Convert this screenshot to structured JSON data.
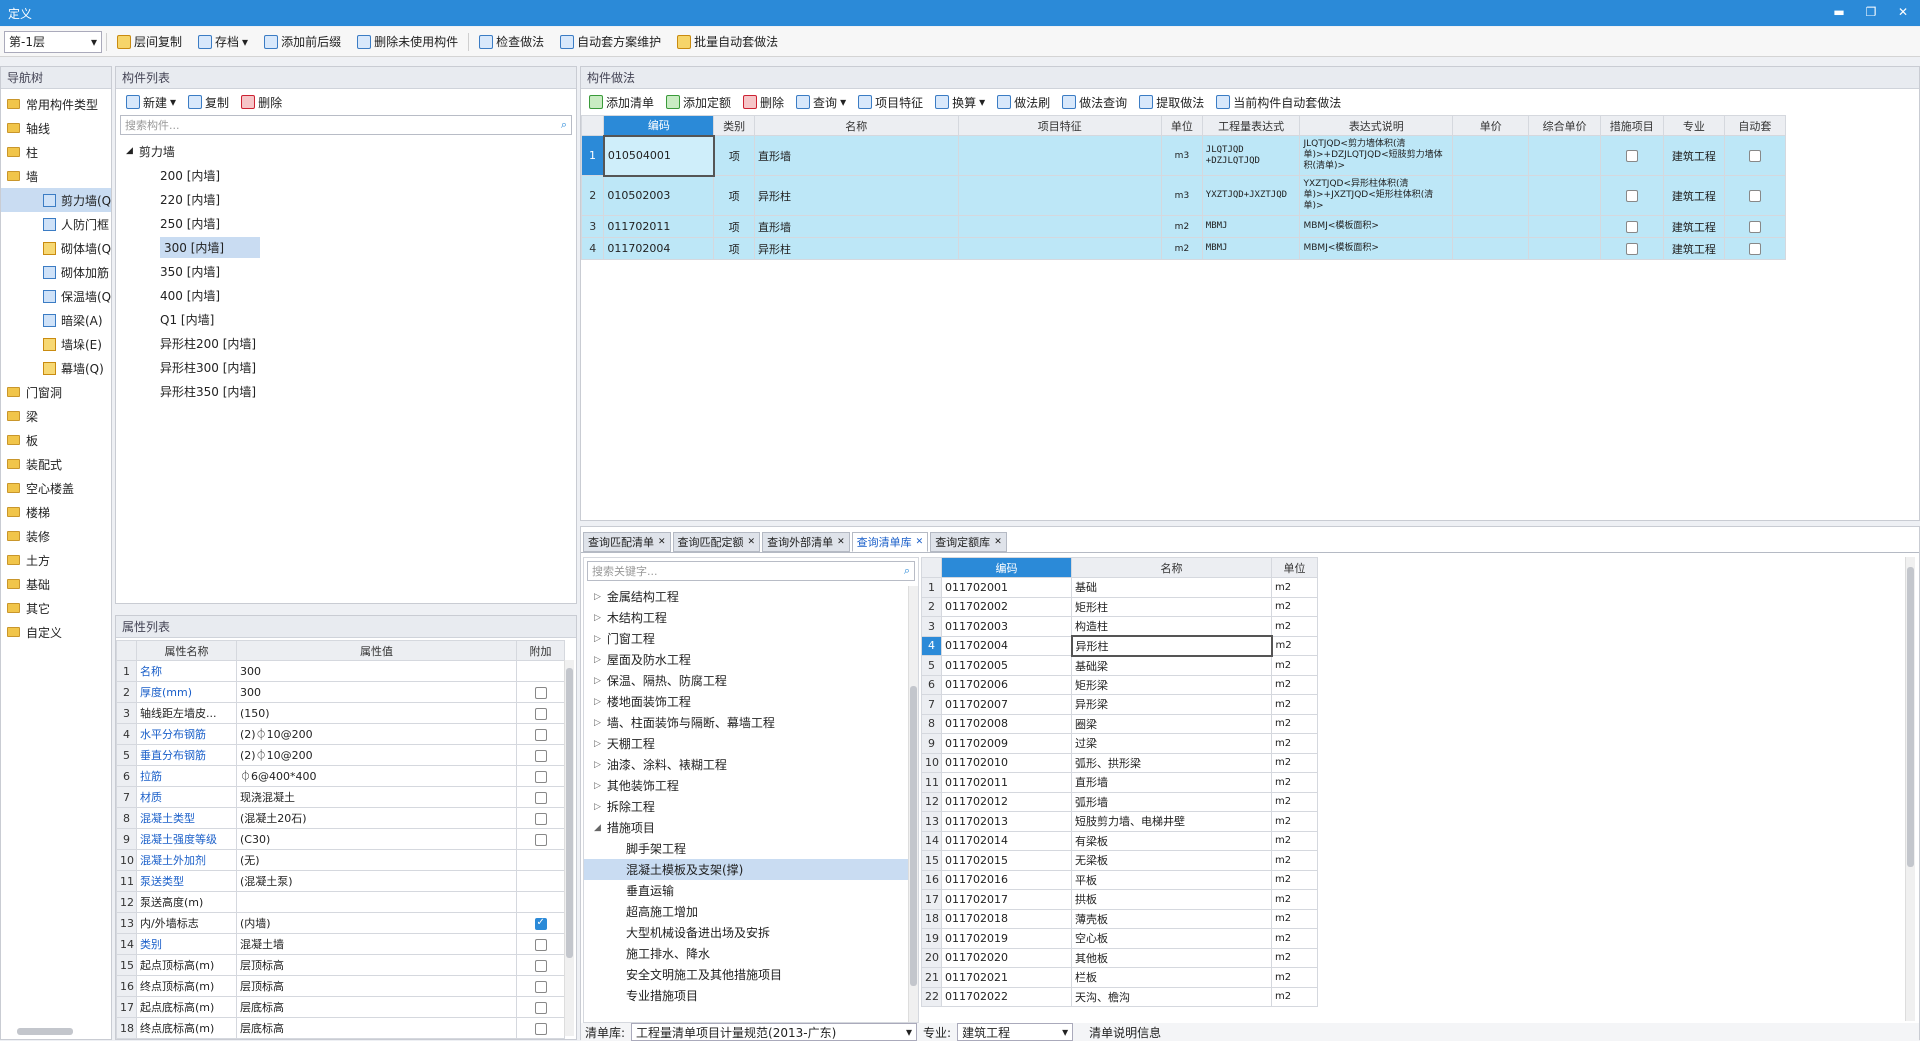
{
  "window": {
    "title": "定义",
    "min": "▬",
    "restore": "❐",
    "close": "✕"
  },
  "toolbar": {
    "floor": "第-1层",
    "items": [
      "层间复制",
      "存档",
      "添加前后缀",
      "删除未使用构件",
      "检查做法",
      "自动套方案维护",
      "批量自动套做法"
    ]
  },
  "nav": {
    "title": "导航树",
    "top": [
      {
        "label": "常用构件类型"
      },
      {
        "label": "轴线"
      },
      {
        "label": "柱"
      },
      {
        "label": "墙"
      }
    ],
    "wall_children": [
      "剪力墙(Q)",
      "人防门框",
      "砌体墙(Q)",
      "砌体加筋",
      "保温墙(Q)",
      "暗梁(A)",
      "墙垛(E)",
      "幕墙(Q)"
    ],
    "bottom": [
      "门窗洞",
      "梁",
      "板",
      "装配式",
      "空心楼盖",
      "楼梯",
      "装修",
      "土方",
      "基础",
      "其它",
      "自定义"
    ]
  },
  "components": {
    "title": "构件列表",
    "new": "新建",
    "copy": "复制",
    "delete": "删除",
    "search_placeholder": "搜索构件...",
    "group": "剪力墙",
    "items": [
      "200 [内墙]",
      "220 [内墙]",
      "250 [内墙]",
      "300 [内墙]",
      "350 [内墙]",
      "400 [内墙]",
      "Q1 [内墙]",
      "异形柱200 [内墙]",
      "异形柱300 [内墙]",
      "异形柱350 [内墙]"
    ],
    "selected_index": 3
  },
  "props": {
    "title": "属性列表",
    "headers": [
      "属性名称",
      "属性值",
      "附加"
    ],
    "rows": [
      {
        "n": "名称",
        "v": "300",
        "blue": true,
        "cb": null
      },
      {
        "n": "厚度(mm)",
        "v": "300",
        "blue": true,
        "cb": false
      },
      {
        "n": "轴线距左墙皮...",
        "v": "(150)",
        "blue": false,
        "cb": false
      },
      {
        "n": "水平分布钢筋",
        "v": "(2)⏀10@200",
        "blue": true,
        "cb": false
      },
      {
        "n": "垂直分布钢筋",
        "v": "(2)⏀10@200",
        "blue": true,
        "cb": false
      },
      {
        "n": "拉筋",
        "v": "⏀6@400*400",
        "blue": true,
        "cb": false
      },
      {
        "n": "材质",
        "v": "现浇混凝土",
        "blue": true,
        "cb": false
      },
      {
        "n": "混凝土类型",
        "v": "(混凝土20石)",
        "blue": true,
        "cb": false
      },
      {
        "n": "混凝土强度等级",
        "v": "(C30)",
        "blue": true,
        "cb": false
      },
      {
        "n": "混凝土外加剂",
        "v": "(无)",
        "blue": true,
        "cb": null
      },
      {
        "n": "泵送类型",
        "v": "(混凝土泵)",
        "blue": true,
        "cb": null
      },
      {
        "n": "泵送高度(m)",
        "v": "",
        "blue": false,
        "cb": null
      },
      {
        "n": "内/外墙标志",
        "v": "(内墙)",
        "blue": false,
        "cb": true
      },
      {
        "n": "类别",
        "v": "混凝土墙",
        "blue": true,
        "cb": false
      },
      {
        "n": "起点顶标高(m)",
        "v": "层顶标高",
        "blue": false,
        "cb": false
      },
      {
        "n": "终点顶标高(m)",
        "v": "层顶标高",
        "blue": false,
        "cb": false
      },
      {
        "n": "起点底标高(m)",
        "v": "层底标高",
        "blue": false,
        "cb": false
      },
      {
        "n": "终点底标高(m)",
        "v": "层底标高",
        "blue": false,
        "cb": false
      }
    ]
  },
  "method": {
    "title": "构件做法",
    "toolbar": [
      "添加清单",
      "添加定额",
      "删除",
      "查询",
      "项目特征",
      "换算",
      "做法刷",
      "做法查询",
      "提取做法",
      "当前构件自动套做法"
    ],
    "headers": [
      "编码",
      "类别",
      "名称",
      "项目特征",
      "单位",
      "工程量表达式",
      "表达式说明",
      "单价",
      "综合单价",
      "措施项目",
      "专业",
      "自动套"
    ],
    "rows": [
      {
        "code": "010504001",
        "cat": "项",
        "name": "直形墙",
        "unit": "m3",
        "expr": "JLQTJQD +DZJLQTJQD",
        "desc": "JLQTJQD<剪力墙体积(清单)>+DZJLQTJQD<短肢剪力墙体积(清单)>",
        "major": "建筑工程"
      },
      {
        "code": "010502003",
        "cat": "项",
        "name": "异形柱",
        "unit": "m3",
        "expr": "YXZTJQD+JXZTJQD",
        "desc": "YXZTJQD<异形柱体积(清单)>+JXZTJQD<矩形柱体积(清单)>",
        "major": "建筑工程"
      },
      {
        "code": "011702011",
        "cat": "项",
        "name": "直形墙",
        "unit": "m2",
        "expr": "MBMJ",
        "desc": "MBMJ<模板面积>",
        "major": "建筑工程"
      },
      {
        "code": "011702004",
        "cat": "项",
        "name": "异形柱",
        "unit": "m2",
        "expr": "MBMJ",
        "desc": "MBMJ<模板面积>",
        "major": "建筑工程"
      }
    ]
  },
  "query": {
    "tabs": [
      "查询匹配清单",
      "查询匹配定额",
      "查询外部清单",
      "查询清单库",
      "查询定额库"
    ],
    "active_tab": 3,
    "search_placeholder": "搜索关键字...",
    "tree": [
      "金属结构工程",
      "木结构工程",
      "门窗工程",
      "屋面及防水工程",
      "保温、隔热、防腐工程",
      "楼地面装饰工程",
      "墙、柱面装饰与隔断、幕墙工程",
      "天棚工程",
      "油漆、涂料、裱糊工程",
      "其他装饰工程",
      "拆除工程"
    ],
    "open_node": "措施项目",
    "children": [
      "脚手架工程",
      "混凝土模板及支架(撑)",
      "垂直运输",
      "超高施工增加",
      "大型机械设备进出场及安拆",
      "施工排水、降水",
      "安全文明施工及其他措施项目",
      "专业措施项目"
    ],
    "selected_child": 1,
    "headers": [
      "编码",
      "名称",
      "单位"
    ],
    "rows": [
      [
        "011702001",
        "基础",
        "m2"
      ],
      [
        "011702002",
        "矩形柱",
        "m2"
      ],
      [
        "011702003",
        "构造柱",
        "m2"
      ],
      [
        "011702004",
        "异形柱",
        "m2"
      ],
      [
        "011702005",
        "基础梁",
        "m2"
      ],
      [
        "011702006",
        "矩形梁",
        "m2"
      ],
      [
        "011702007",
        "异形梁",
        "m2"
      ],
      [
        "011702008",
        "圈梁",
        "m2"
      ],
      [
        "011702009",
        "过梁",
        "m2"
      ],
      [
        "011702010",
        "弧形、拱形梁",
        "m2"
      ],
      [
        "011702011",
        "直形墙",
        "m2"
      ],
      [
        "011702012",
        "弧形墙",
        "m2"
      ],
      [
        "011702013",
        "短肢剪力墙、电梯井壁",
        "m2"
      ],
      [
        "011702014",
        "有梁板",
        "m2"
      ],
      [
        "011702015",
        "无梁板",
        "m2"
      ],
      [
        "011702016",
        "平板",
        "m2"
      ],
      [
        "011702017",
        "拱板",
        "m2"
      ],
      [
        "011702018",
        "薄壳板",
        "m2"
      ],
      [
        "011702019",
        "空心板",
        "m2"
      ],
      [
        "011702020",
        "其他板",
        "m2"
      ],
      [
        "011702021",
        "栏板",
        "m2"
      ],
      [
        "011702022",
        "天沟、檐沟",
        "m2"
      ]
    ],
    "selected_row": 3,
    "footer": {
      "lib_label": "清单库:",
      "lib_value": "工程量清单项目计量规范(2013-广东)",
      "major_label": "专业:",
      "major_value": "建筑工程",
      "info": "清单说明信息"
    }
  }
}
